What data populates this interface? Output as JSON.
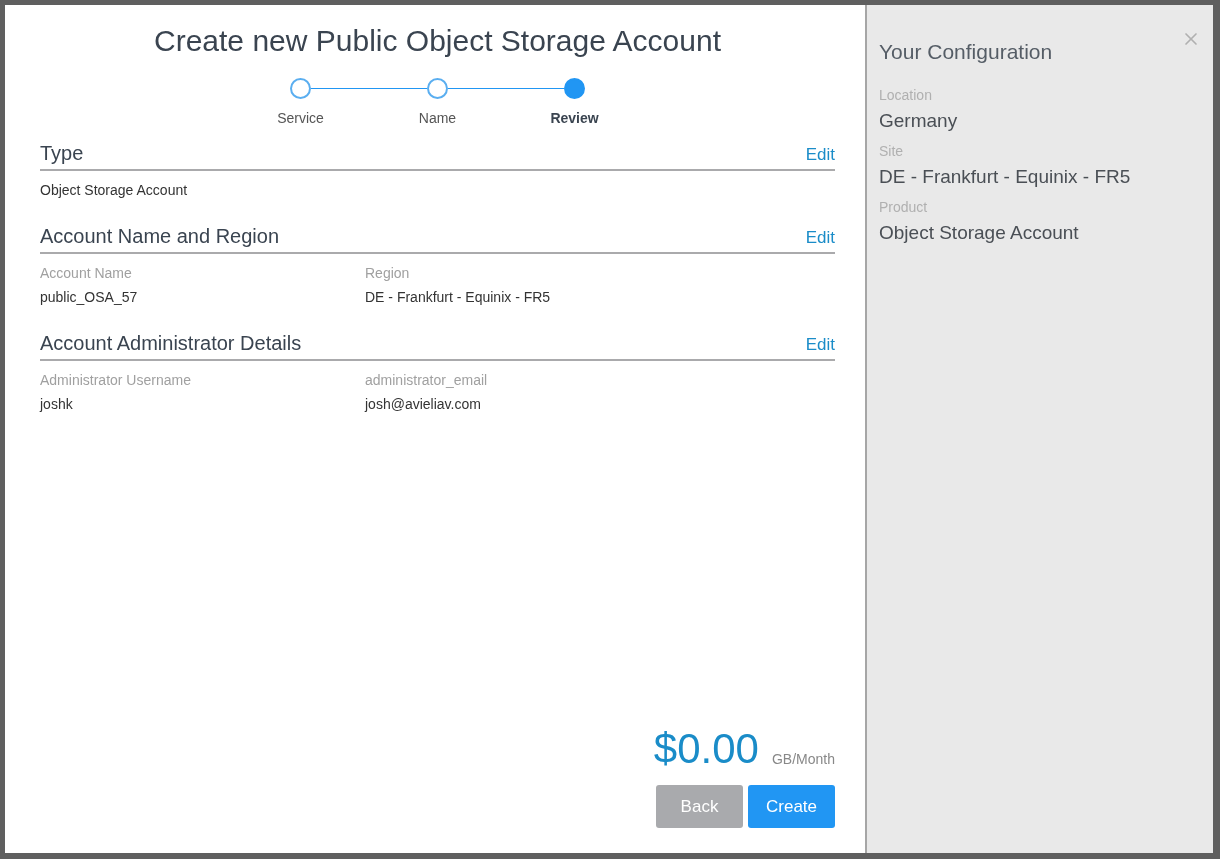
{
  "dialog": {
    "title": "Create new Public Object Storage Account"
  },
  "steps": [
    {
      "label": "Service",
      "selected": false
    },
    {
      "label": "Name",
      "selected": false
    },
    {
      "label": "Review",
      "selected": true
    }
  ],
  "sections": [
    {
      "title": "Type",
      "edit": "Edit",
      "fields": [
        {
          "value": "Object Storage Account"
        }
      ]
    },
    {
      "title": "Account Name and Region",
      "edit": "Edit",
      "fields": [
        {
          "label": "Account Name",
          "value": "public_OSA_57"
        },
        {
          "label": "Region",
          "value": "DE - Frankfurt - Equinix - FR5"
        }
      ]
    },
    {
      "title": "Account Administrator Details",
      "edit": "Edit",
      "fields": [
        {
          "label": "Administrator Username",
          "value": "joshk"
        },
        {
          "label": "administrator_email",
          "value": "josh@avieliav.com"
        }
      ]
    }
  ],
  "price": {
    "amount": "$0.00",
    "unit": "GB/Month"
  },
  "buttons": [
    {
      "label": "Back",
      "kind": "secondary"
    },
    {
      "label": "Create",
      "kind": "primary"
    }
  ],
  "sidebar": {
    "title": "Your Configuration",
    "items": [
      {
        "label": "Location",
        "value": "Germany"
      },
      {
        "label": "Site",
        "value": "DE - Frankfurt - Equinix - FR5"
      },
      {
        "label": "Product",
        "value": "Object Storage Account"
      }
    ]
  }
}
